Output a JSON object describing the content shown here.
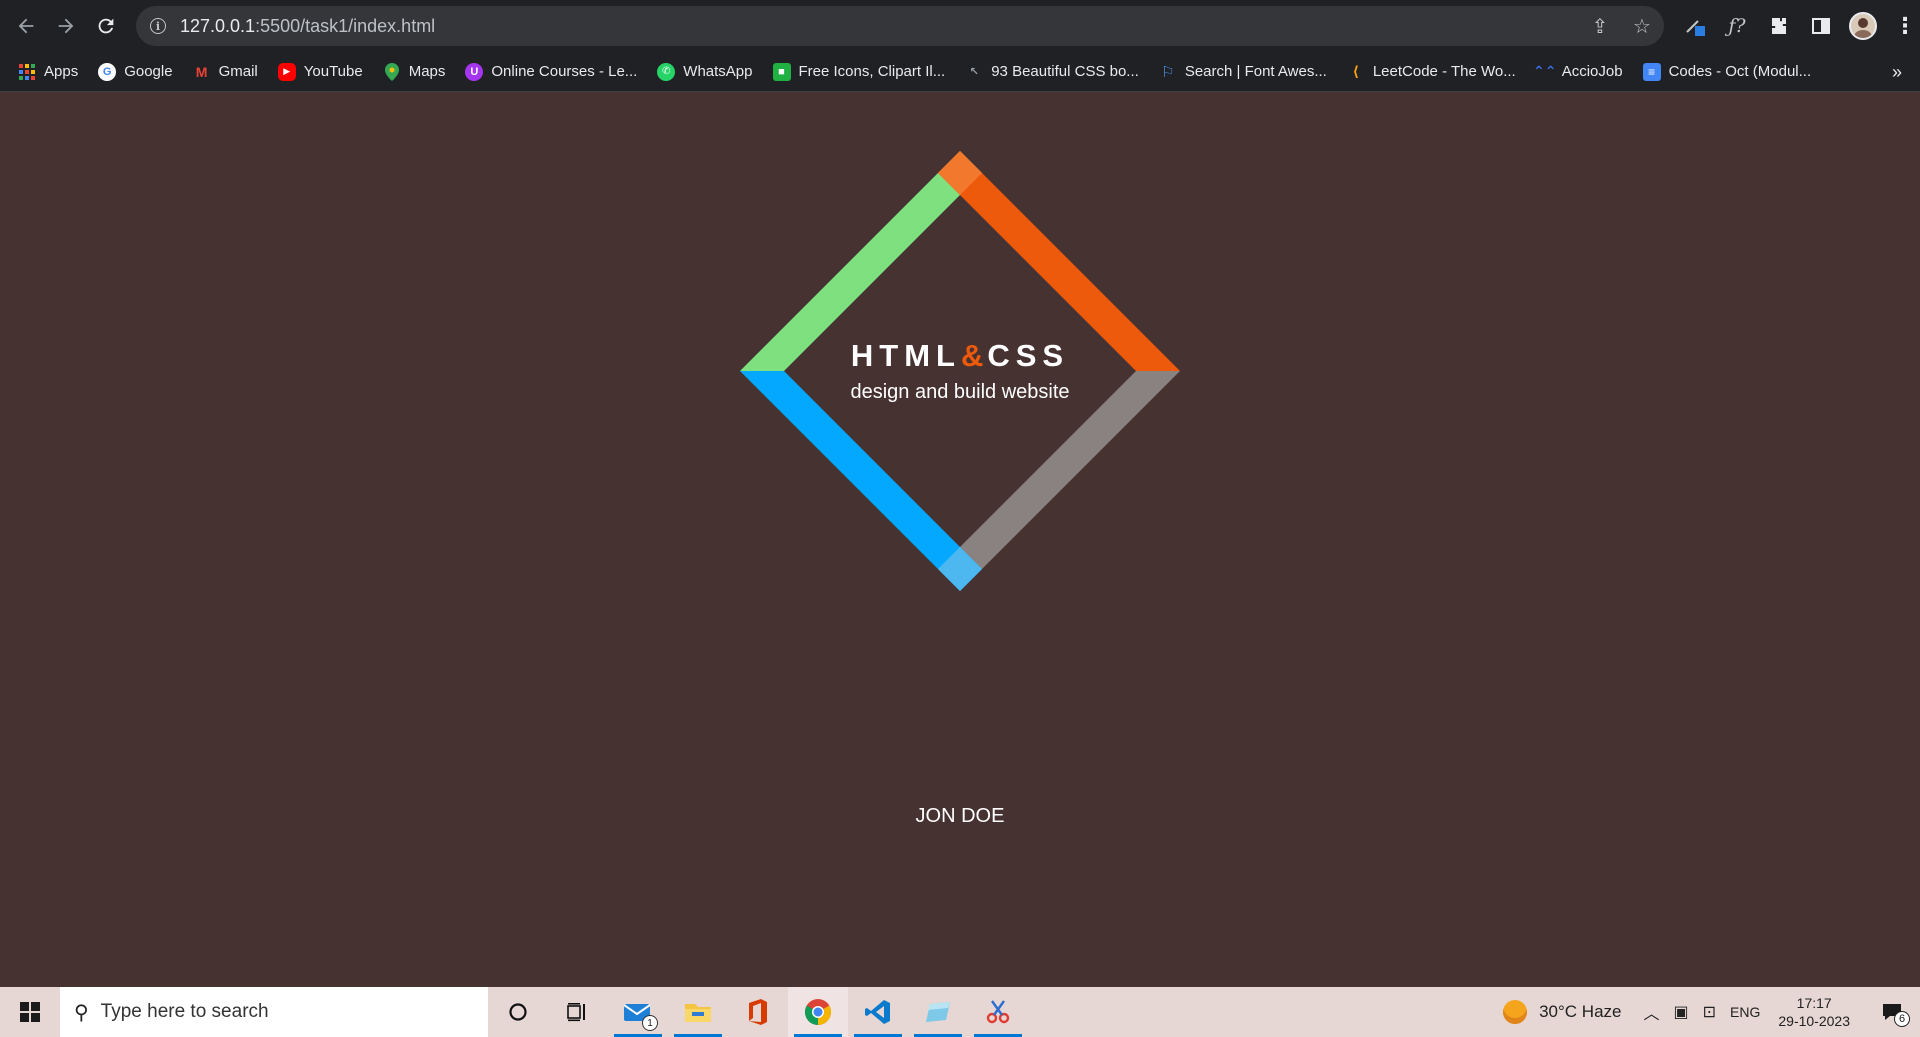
{
  "browser": {
    "url_host": "127.0.0.1",
    "url_rest": ":5500/task1/index.html",
    "bookmarks": [
      {
        "label": "Apps",
        "icon": "apps-grid-icon",
        "color": "#ea4335"
      },
      {
        "label": "Google",
        "icon": "google-icon",
        "color": "#4285f4"
      },
      {
        "label": "Gmail",
        "icon": "gmail-icon",
        "color": "#ea4335"
      },
      {
        "label": "YouTube",
        "icon": "youtube-icon",
        "color": "#ff0000"
      },
      {
        "label": "Maps",
        "icon": "maps-pin-icon",
        "color": "#34a853"
      },
      {
        "label": "Online Courses - Le...",
        "icon": "udemy-icon",
        "color": "#a435f0"
      },
      {
        "label": "WhatsApp",
        "icon": "whatsapp-icon",
        "color": "#25d366"
      },
      {
        "label": "Free Icons, Clipart Il...",
        "icon": "icons8-icon",
        "color": "#1fb141"
      },
      {
        "label": "93 Beautiful CSS bo...",
        "icon": "cursor-icon",
        "color": "#3a3a3a"
      },
      {
        "label": "Search | Font Awes...",
        "icon": "flag-icon",
        "color": "#4a90e2"
      },
      {
        "label": "LeetCode - The Wo...",
        "icon": "leetcode-icon",
        "color": "#ffa116"
      },
      {
        "label": "AccioJob",
        "icon": "acciojob-icon",
        "color": "#3b6de0"
      },
      {
        "label": "Codes - Oct (Modul...",
        "icon": "docs-icon",
        "color": "#4285f4"
      }
    ]
  },
  "page": {
    "logo_html": "HTML",
    "logo_amp": "&",
    "logo_css": "CSS",
    "subtitle": "design and build website",
    "author": "JON DOE",
    "colors": {
      "background": "#463331",
      "green": "#7ee07f",
      "orange": "#ee5a0b",
      "orange_light": "#f2782e",
      "blue": "#04a8ff",
      "blue_light": "#4db7f0",
      "gray": "#8a8181"
    }
  },
  "taskbar": {
    "search_placeholder": "Type here to search",
    "mail_badge": "1",
    "weather": "30°C  Haze",
    "lang": "ENG",
    "time": "17:17",
    "date": "29-10-2023",
    "notif_count": "6"
  }
}
